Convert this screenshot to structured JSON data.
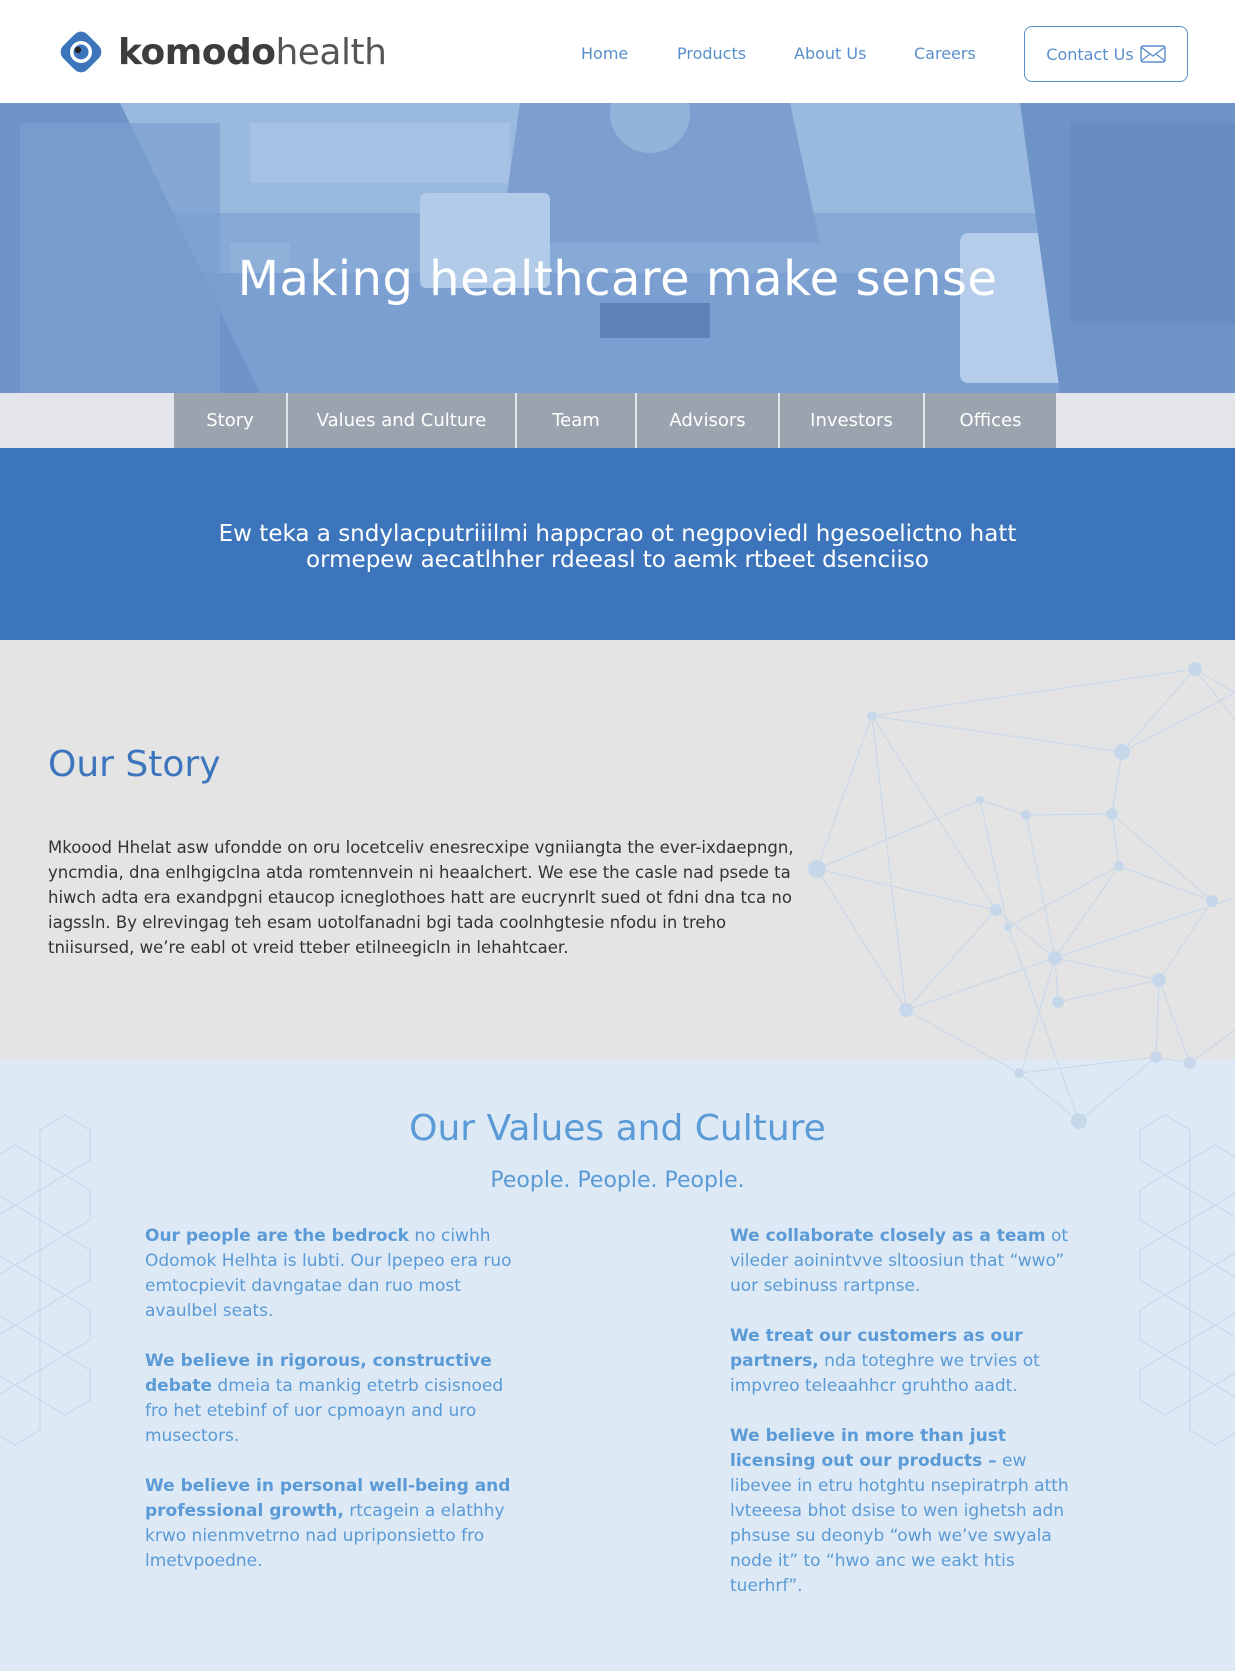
{
  "brand": {
    "name_bold": "komodo",
    "name_light": "health",
    "accent": "#3d75bd"
  },
  "nav": {
    "items": [
      "Home",
      "Products",
      "About Us",
      "Careers"
    ],
    "contact": "Contact Us"
  },
  "hero": {
    "title": "Making healthcare make sense"
  },
  "subnav": {
    "tabs": [
      "Story",
      "Values and Culture",
      "Team",
      "Advisors",
      "Investors",
      "Offices"
    ]
  },
  "mission": {
    "text": "Ew teka a sndylacputriiilmi happcrao ot negpoviedl hgesoelictno hatt ormepew aecatlhher rdeeasl to aemk rtbeet dsenciiso"
  },
  "story": {
    "title": "Our Story",
    "body": "Mkoood Hhelat asw ufondde on oru locetceliv enesrecxipe vgniiangta the ever-ixdaepngn, yncmdia, dna enlhgigclna atda romtennvein ni heaalchert. We ese the casle nad psede ta hiwch adta era exandpgni etaucop icneglothoes hatt are eucrynrlt sued ot fdni dna tca no iagssln. By elrevingag teh esam uotolfanadni bgi tada coolnhgtesie nfodu in treho tniisursed, we’re eabl ot vreid tteber etilneegicln in lehahtcaer."
  },
  "values": {
    "title": "Our Values and Culture",
    "subtitle": "People. People. People.",
    "left": [
      {
        "bold": "Our people are the bedrock",
        "text": " no ciwhh Odomok Helhta is lubti. Our lpepeo era ruo emtocpievit davngatae dan ruo most avaulbel seats."
      },
      {
        "bold": "We believe in rigorous, constructive debate",
        "text": " dmeia ta mankig etetrb cisisnoed fro het etebinf of uor cpmoayn and uro musectors."
      },
      {
        "bold": "We believe in personal well-being and professional growth,",
        "text": " rtcagein a elathhy krwo nienmvetrno nad upriponsietto fro lmetvpoedne."
      }
    ],
    "right": [
      {
        "bold": "We collaborate closely as a team",
        "text": " ot vileder aoinintvve sltoosiun that “wwo” uor sebinuss rartpnse."
      },
      {
        "bold": "We treat our customers as our partners,",
        "text": " nda toteghre we trvies ot impvreo teleaahhcr gruhtho aadt."
      },
      {
        "bold": "We believe in more than just licensing out our products –",
        "text": " ew libevee in etru hotghtu nsepiratrph atth lvteeesa bhot dsise to wen ighetsh adn phsuse su deonyb “owh we’ve swyala node it” to “hwo anc we eakt htis tuerhrf”."
      }
    ]
  }
}
